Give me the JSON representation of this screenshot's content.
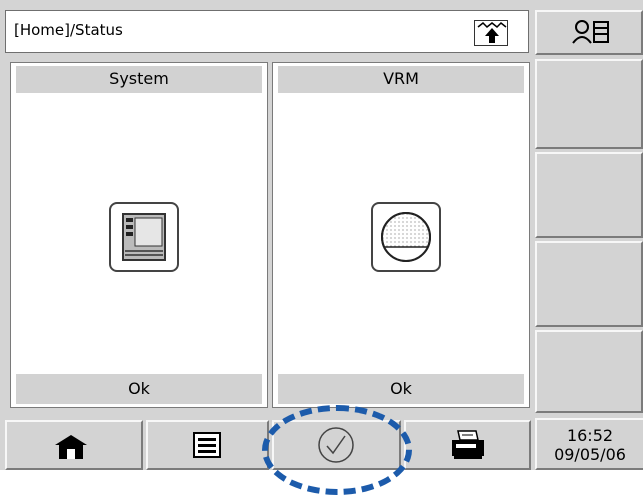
{
  "header": {
    "title": "[Home]/Status",
    "icons": [
      "upload-arrow-icon",
      "user-list-icon"
    ]
  },
  "panels": [
    {
      "title": "System",
      "status": "Ok",
      "icon": "system-cabinet-icon"
    },
    {
      "title": "VRM",
      "status": "Ok",
      "icon": "vrm-sphere-icon"
    }
  ],
  "toolbar": {
    "buttons": [
      "home-icon",
      "list-icon",
      "acknowledge-check-icon",
      "printer-icon"
    ]
  },
  "clock": {
    "time": "16:52",
    "date": "09/05/06"
  },
  "colors": {
    "highlight": "#1c5bab",
    "button_face": "#d3d3d3"
  }
}
